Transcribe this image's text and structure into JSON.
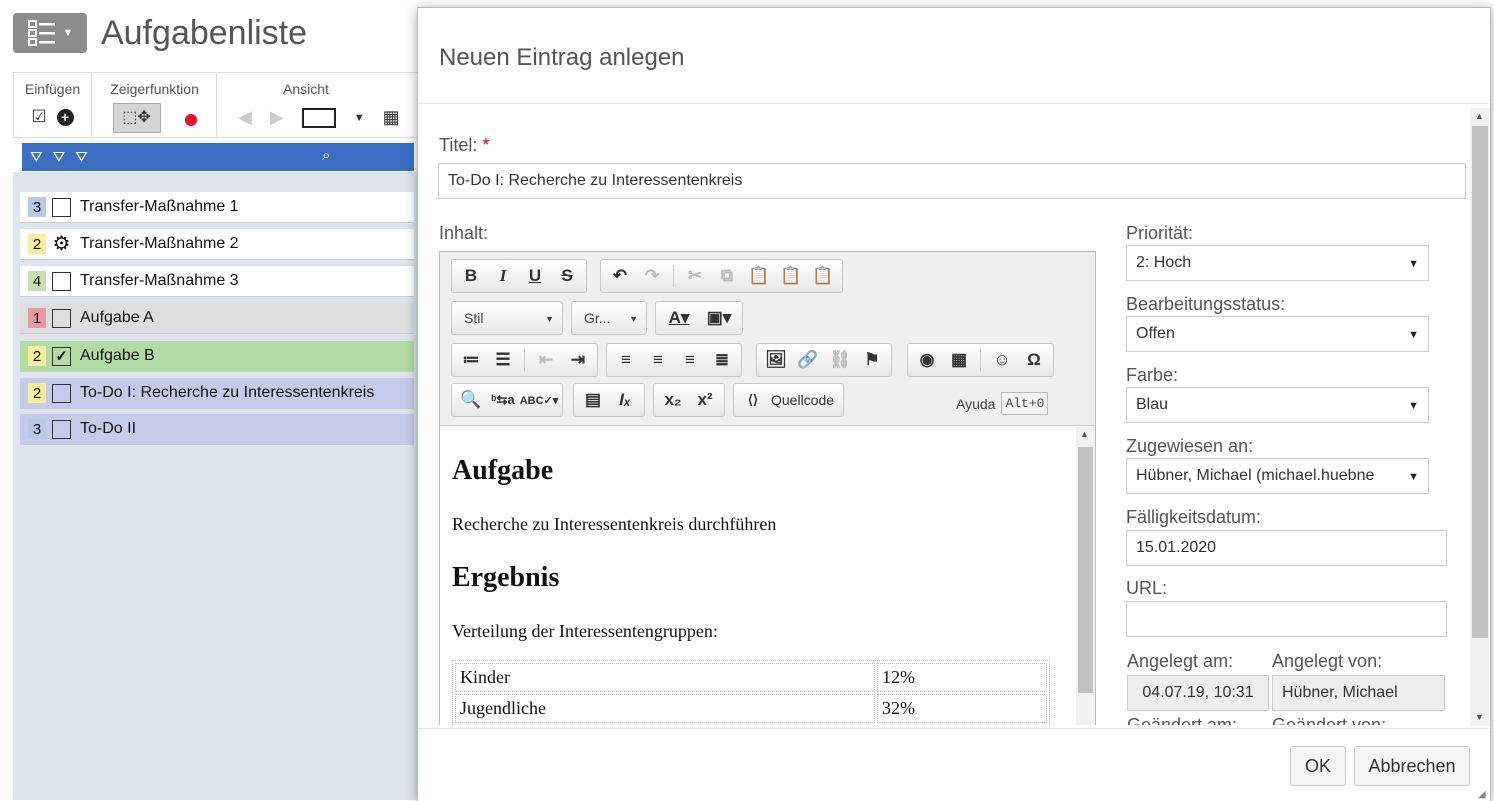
{
  "app": {
    "title": "Aufgabenliste",
    "ribbon": {
      "insert_label": "Einfügen",
      "pointer_label": "Zeigerfunktion",
      "view_label": "Ansicht"
    }
  },
  "tasks": [
    {
      "priority": "3",
      "priority_color": "#b9c9ea",
      "icon": "checkbox",
      "label": "Transfer-Maßnahme 1",
      "bg": "#ffffff"
    },
    {
      "priority": "2",
      "priority_color": "#f7ed9a",
      "icon": "gear-icon",
      "label": "Transfer-Maßnahme 2",
      "bg": "#ffffff"
    },
    {
      "priority": "4",
      "priority_color": "#c4e0b0",
      "icon": "checkbox",
      "label": "Transfer-Maßnahme 3",
      "bg": "#ffffff"
    },
    {
      "priority": "1",
      "priority_color": "#e89aa4",
      "icon": "checkbox",
      "label": "Aufgabe A",
      "bg": "#dedede"
    },
    {
      "priority": "2",
      "priority_color": "#f7ed9a",
      "icon": "checkbox-checked",
      "label": "Aufgabe B",
      "bg": "#b2dca4"
    },
    {
      "priority": "2",
      "priority_color": "#f7ed9a",
      "icon": "checkbox",
      "label": "To-Do I: Recherche zu Interessentenkreis",
      "bg": "#c5cbea"
    },
    {
      "priority": "3",
      "priority_color": "#b9c9ea",
      "icon": "checkbox",
      "label": "To-Do II",
      "bg": "#c5cbea"
    }
  ],
  "dialog": {
    "title": "Neuen Eintrag anlegen",
    "title_label": "Titel:",
    "required_mark": "*",
    "title_value": "To-Do I: Recherche zu Interessentenkreis",
    "content_label": "Inhalt:",
    "editor": {
      "style_combo": "Stil",
      "size_combo": "Gr...",
      "source_button": "Quellcode",
      "help_label": "Ayuda",
      "help_shortcut": "Alt+0",
      "heading1": "Aufgabe",
      "paragraph1": "Recherche zu Interessentenkreis durchführen",
      "heading2": "Ergebnis",
      "paragraph2": "Verteilung der Interessentengruppen:",
      "table": [
        [
          "Kinder",
          "12%"
        ],
        [
          "Jugendliche",
          "32%"
        ]
      ]
    },
    "priority_label": "Priorität:",
    "priority_value": "2: Hoch",
    "status_label": "Bearbeitungsstatus:",
    "status_value": "Offen",
    "color_label": "Farbe:",
    "color_value": "Blau",
    "assigned_label": "Zugewiesen an:",
    "assigned_value": "Hübner, Michael (michael.huebne",
    "due_label": "Fälligkeitsdatum:",
    "due_value": "15.01.2020",
    "url_label": "URL:",
    "url_value": "",
    "created_at_label": "Angelegt am:",
    "created_at_value": "04.07.19, 10:31",
    "created_by_label": "Angelegt von:",
    "created_by_value": "Hübner, Michael",
    "changed_at_label": "Geändert am:",
    "changed_by_label": "Geändert von:",
    "ok_button": "OK",
    "cancel_button": "Abbrechen"
  }
}
